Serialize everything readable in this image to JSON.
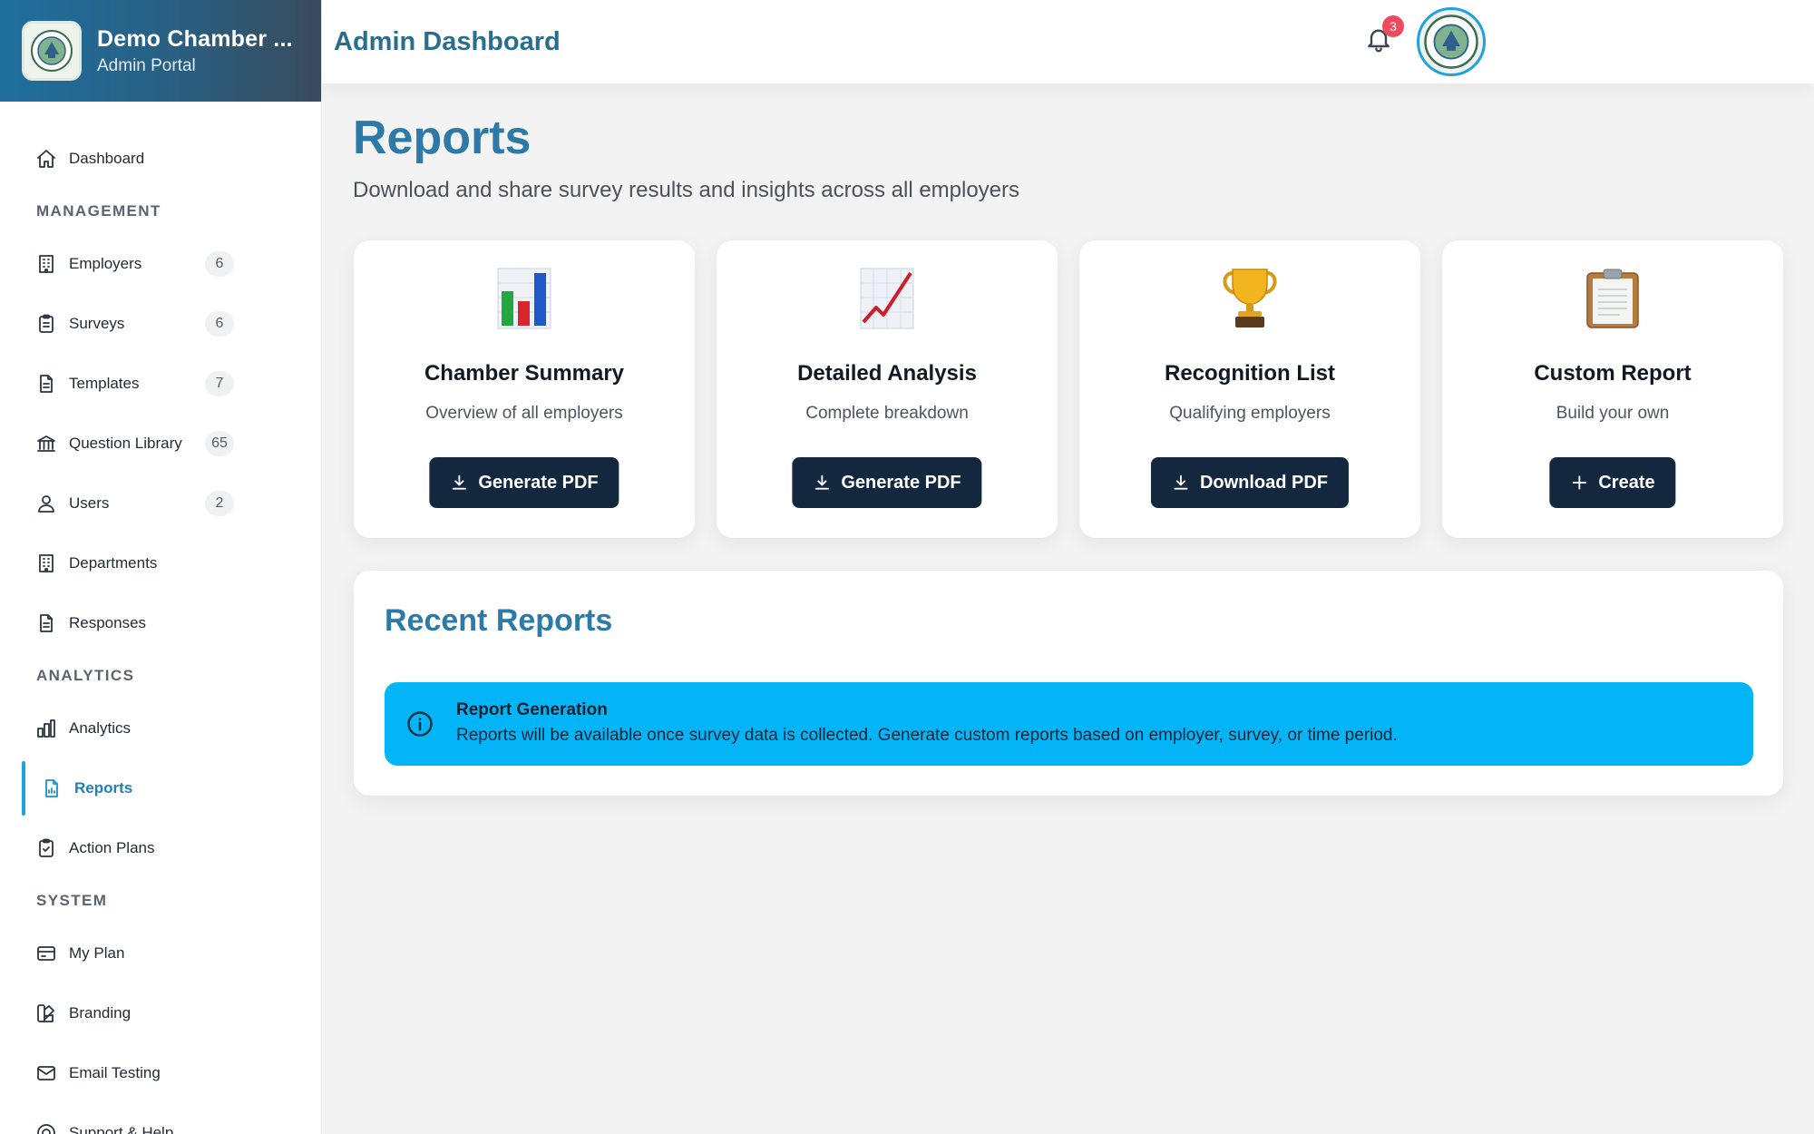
{
  "brand": {
    "title": "Demo Chamber ...",
    "subtitle": "Admin Portal"
  },
  "header": {
    "title": "Admin Dashboard",
    "notification_count": "3"
  },
  "sidebar": {
    "items": [
      {
        "label": "Dashboard",
        "icon": "home-icon"
      },
      {
        "section": "MANAGEMENT"
      },
      {
        "label": "Employers",
        "icon": "building-icon",
        "badge": "6"
      },
      {
        "label": "Surveys",
        "icon": "clipboard-icon",
        "badge": "6"
      },
      {
        "label": "Templates",
        "icon": "document-icon",
        "badge": "7"
      },
      {
        "label": "Question Library",
        "icon": "library-icon",
        "badge": "65"
      },
      {
        "label": "Users",
        "icon": "users-icon",
        "badge": "2"
      },
      {
        "label": "Departments",
        "icon": "building-icon"
      },
      {
        "label": "Responses",
        "icon": "document-icon"
      },
      {
        "section": "ANALYTICS"
      },
      {
        "label": "Analytics",
        "icon": "bar-chart-icon"
      },
      {
        "label": "Reports",
        "icon": "report-icon",
        "active": true
      },
      {
        "label": "Action Plans",
        "icon": "clipboard-check-icon"
      },
      {
        "section": "SYSTEM"
      },
      {
        "label": "My Plan",
        "icon": "credit-card-icon"
      },
      {
        "label": "Branding",
        "icon": "palette-icon"
      },
      {
        "label": "Email Testing",
        "icon": "mail-icon"
      },
      {
        "label": "Support & Help",
        "icon": "help-icon"
      }
    ]
  },
  "page": {
    "title": "Reports",
    "subtitle": "Download and share survey results and insights across all employers"
  },
  "cards": [
    {
      "title": "Chamber Summary",
      "subtitle": "Overview of all employers",
      "button": "Generate PDF",
      "button_icon": "download-icon",
      "icon": "bar-chart-emoji-icon"
    },
    {
      "title": "Detailed Analysis",
      "subtitle": "Complete breakdown",
      "button": "Generate PDF",
      "button_icon": "download-icon",
      "icon": "trend-up-emoji-icon"
    },
    {
      "title": "Recognition List",
      "subtitle": "Qualifying employers",
      "button": "Download PDF",
      "button_icon": "download-icon",
      "icon": "trophy-emoji-icon"
    },
    {
      "title": "Custom Report",
      "subtitle": "Build your own",
      "button": "Create",
      "button_icon": "plus-icon",
      "icon": "clipboard-emoji-icon"
    }
  ],
  "recent": {
    "title": "Recent Reports",
    "alert_title": "Report Generation",
    "alert_text": "Reports will be available once survey data is collected. Generate custom reports based on employer, survey, or time period."
  },
  "colors": {
    "accent": "#1fa3e0",
    "title_blue": "#2d7aa8",
    "button_dark": "#13273f",
    "alert_bg": "#03b5f7",
    "badge_red": "#ef4b5d"
  }
}
